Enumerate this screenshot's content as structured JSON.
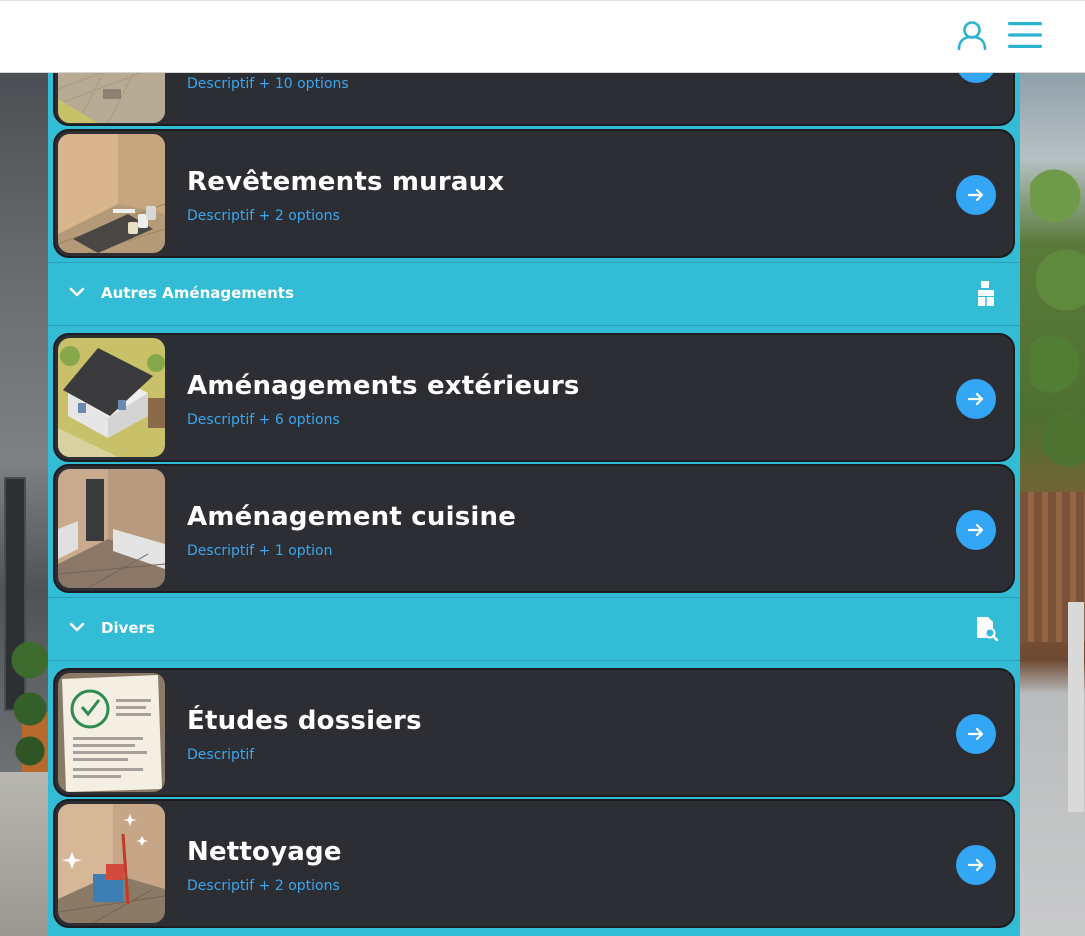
{
  "header": {
    "user_icon": "user-icon",
    "menu_icon": "hamburger-menu-icon"
  },
  "cards": [
    {
      "title": "",
      "subtitle": "Descriptif + 10 options",
      "thumb": "floor-tiles"
    },
    {
      "title": "Revêtements muraux",
      "subtitle": "Descriptif + 2 options",
      "thumb": "wall-paint"
    },
    {
      "title": "Aménagements extérieurs",
      "subtitle": "Descriptif + 6 options",
      "thumb": "house-exterior"
    },
    {
      "title": "Aménagement cuisine",
      "subtitle": "Descriptif + 1 option",
      "thumb": "kitchen"
    },
    {
      "title": "Études dossiers",
      "subtitle": "Descriptif",
      "thumb": "document-re2020"
    },
    {
      "title": "Nettoyage",
      "subtitle": "Descriptif + 2 options",
      "thumb": "cleaning"
    }
  ],
  "sections": [
    {
      "label": "Autres Aménagements",
      "icon": "boxes-icon"
    },
    {
      "label": "Divers",
      "icon": "document-search-icon"
    }
  ],
  "colors": {
    "panel": "#33bcd6",
    "card": "#2d2e33",
    "accent": "#33a6f5",
    "subtitle": "#3aa6f0"
  }
}
